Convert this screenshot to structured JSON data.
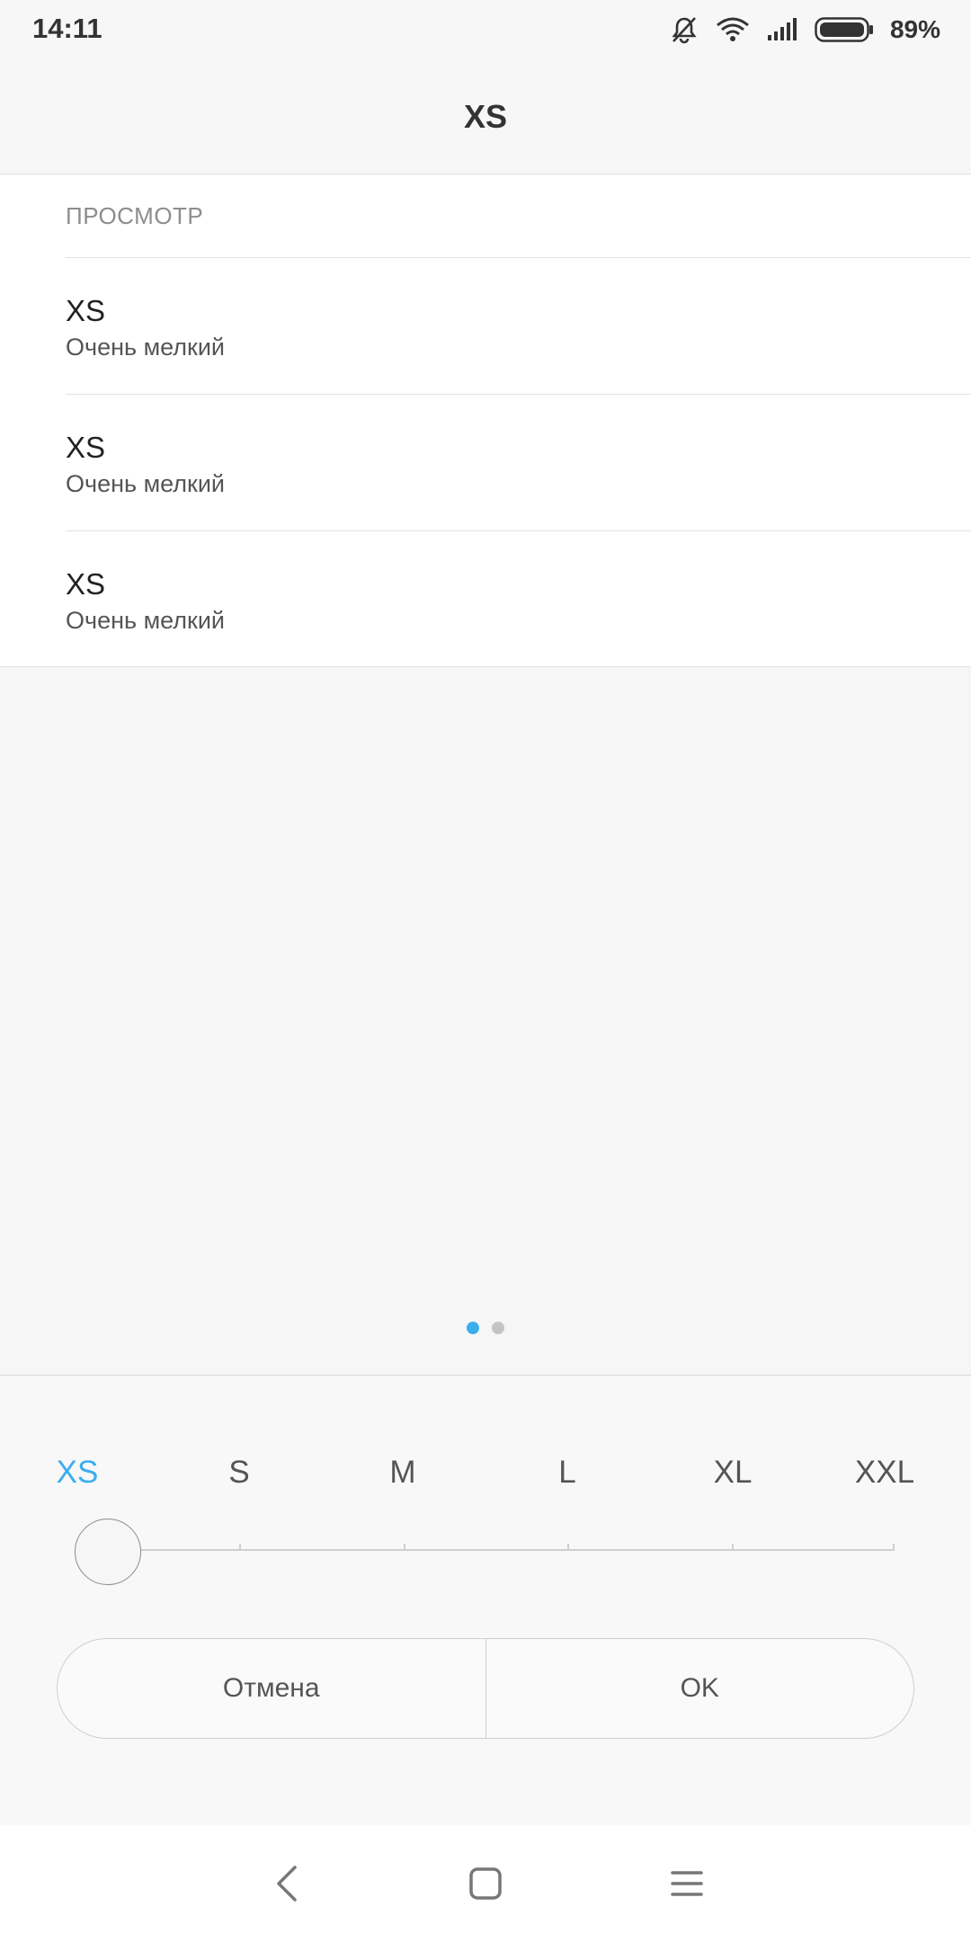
{
  "status_bar": {
    "time": "14:11",
    "battery_percent": "89%",
    "icons": [
      "notifications-muted-icon",
      "wifi-icon",
      "signal-icon",
      "battery-icon"
    ]
  },
  "title_bar": {
    "title": "XS"
  },
  "preview": {
    "section_header": "ПРОСМОТР",
    "items": [
      {
        "title": "XS",
        "summary": "Очень мелкий"
      },
      {
        "title": "XS",
        "summary": "Очень мелкий"
      },
      {
        "title": "XS",
        "summary": "Очень мелкий"
      }
    ]
  },
  "pager": {
    "page_count": 2,
    "current_page": 1
  },
  "size_selector": {
    "labels": [
      "XS",
      "S",
      "M",
      "L",
      "XL",
      "XXL"
    ],
    "selected": "XS"
  },
  "buttons": {
    "cancel_label": "Отмена",
    "ok_label": "OK"
  },
  "nav_bar": {
    "icons": [
      "back-icon",
      "home-icon",
      "menu-icon"
    ]
  },
  "colors": {
    "accent": "#3aaeef",
    "background": "#f6f6f6",
    "panel": "#ffffff"
  }
}
